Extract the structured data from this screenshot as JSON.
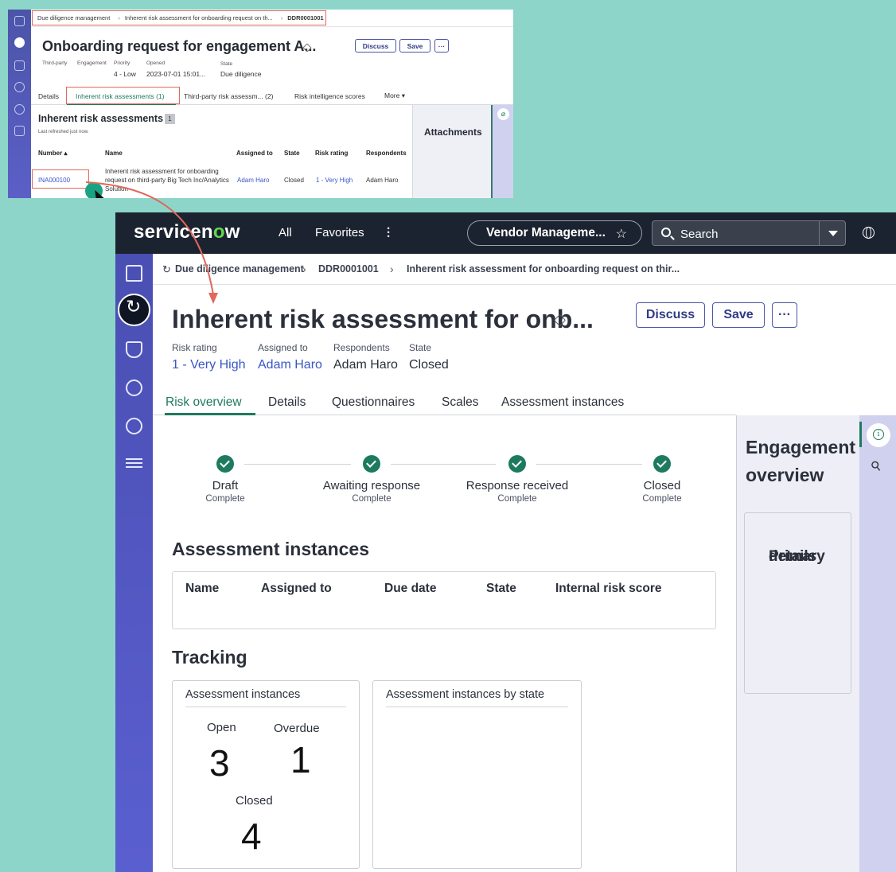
{
  "inset": {
    "breadcrumbs": [
      "Due diligence management",
      "Inherent risk assessment for onboarding request on th...",
      "DDR0001001"
    ],
    "title": "Onboarding request for engagement A...",
    "buttons": {
      "discuss": "Discuss",
      "save": "Save",
      "more": "···"
    },
    "meta": {
      "thirdparty_label": "Third-party",
      "engagement_label": "Engagement",
      "priority_label": "Priority",
      "priority_value": "4 - Low",
      "opened_label": "Opened",
      "opened_value": "2023-07-01 15:01...",
      "state_label": "State",
      "state_value": "Due diligence"
    },
    "tabs": [
      "Details",
      "Inherent risk assessments (1)",
      "Third-party risk assessm... (2)",
      "Risk intelligence scores",
      "More ▾"
    ],
    "section_title": "Inherent risk assessments",
    "section_count": "1",
    "refreshed": "Last refreshed just now.",
    "columns": [
      "Number ▴",
      "Name",
      "Assigned to",
      "State",
      "Risk rating",
      "Respondents"
    ],
    "row": {
      "number": "INA000100",
      "name": "Inherent risk assessment for onboarding request on third-party Big Tech Inc/Analytics Solution",
      "assigned_to": "Adam Haro",
      "state": "Closed",
      "risk_rating": "1 - Very High",
      "respondents": "Adam Haro"
    },
    "attachments_title": "Attachments",
    "attachments_icon": "paperclip-icon"
  },
  "header": {
    "logo": "servicenow",
    "nav": {
      "all": "All",
      "favorites": "Favorites"
    },
    "scope": "Vendor Manageme...",
    "search_placeholder": "Search"
  },
  "breadcrumbs": [
    "Due diligence management",
    "DDR0001001",
    "Inherent risk assessment for onboarding request on thir..."
  ],
  "record": {
    "title": "Inherent risk assessment for onb...",
    "buttons": {
      "discuss": "Discuss",
      "save": "Save",
      "more": "···"
    },
    "fields": [
      {
        "label": "Risk rating",
        "value": "1 - Very High"
      },
      {
        "label": "Assigned to",
        "value": "Adam Haro"
      },
      {
        "label": "Respondents",
        "value": "Adam Haro"
      },
      {
        "label": "State",
        "value": "Closed"
      }
    ]
  },
  "tabs": [
    "Risk overview",
    "Details",
    "Questionnaires",
    "Scales",
    "Assessment instances"
  ],
  "stepper": [
    {
      "label": "Draft",
      "status": "Complete"
    },
    {
      "label": "Awaiting response",
      "status": "Complete"
    },
    {
      "label": "Response received",
      "status": "Complete"
    },
    {
      "label": "Closed",
      "status": "Complete"
    }
  ],
  "assessment_instances": {
    "title": "Assessment instances",
    "columns": [
      "Name",
      "Assigned to",
      "Due date",
      "State",
      "Internal risk score"
    ]
  },
  "tracking": {
    "title": "Tracking",
    "card1": {
      "title": "Assessment instances",
      "open_label": "Open",
      "open_value": "3",
      "overdue_label": "Overdue",
      "overdue_value": "1",
      "closed_label": "Closed",
      "closed_value": "4"
    },
    "card2": {
      "title": "Assessment instances by state"
    }
  },
  "right_panel": {
    "title_line1": "Engagement",
    "title_line2": "overview",
    "primary_line1": "Primary",
    "primary_line2": "details"
  },
  "colors": {
    "accent_green": "#1e7a5e",
    "brand_purple": "#4b55a8",
    "link_blue": "#3856c4",
    "annotation_red": "#e0685c"
  }
}
